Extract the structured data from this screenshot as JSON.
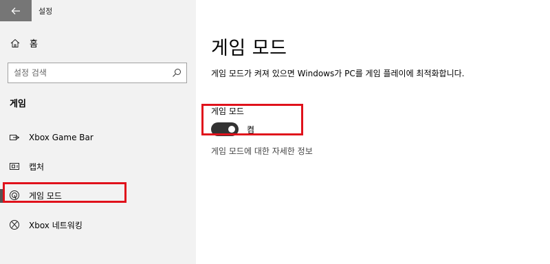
{
  "window": {
    "title": "설정",
    "back_icon": "back-arrow-icon"
  },
  "sidebar": {
    "home": {
      "label": "홈",
      "icon": "home-icon"
    },
    "search": {
      "placeholder": "설정 검색",
      "icon": "search-icon"
    },
    "section_heading": "게임",
    "items": [
      {
        "label": "Xbox Game Bar",
        "icon": "game-bar-icon",
        "selected": false
      },
      {
        "label": "캡처",
        "icon": "capture-icon",
        "selected": false
      },
      {
        "label": "게임 모드",
        "icon": "game-mode-icon",
        "selected": true
      },
      {
        "label": "Xbox 네트워킹",
        "icon": "xbox-icon",
        "selected": false
      }
    ]
  },
  "main": {
    "title": "게임 모드",
    "description": "게임 모드가 켜져 있으면 Windows가 PC를 게임 플레이에 최적화합니다.",
    "setting": {
      "label": "게임 모드",
      "toggle_on": true,
      "toggle_state_text": "켬"
    },
    "link_text": "게임 모드에 대한 자세한 정보"
  },
  "colors": {
    "accent_highlight": "#e0111b",
    "sidebar_bg": "#f2f2f2",
    "back_button_bg": "#767676",
    "toggle_on": "#333333"
  }
}
